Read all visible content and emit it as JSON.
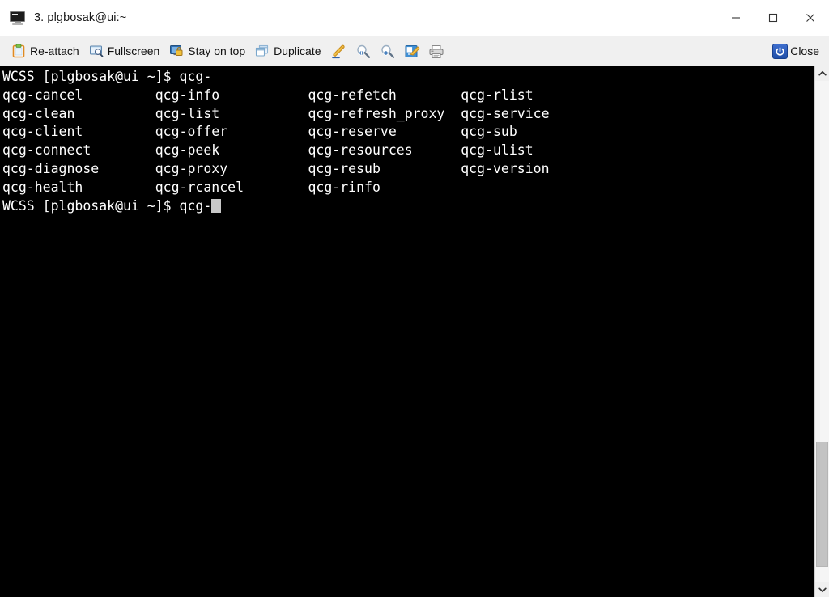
{
  "window": {
    "title": "3. plgbosak@ui:~",
    "app_icon": "monitor-icon",
    "controls": {
      "minimize": "Minimize",
      "maximize": "Maximize",
      "close": "Close"
    }
  },
  "toolbar": {
    "items": [
      {
        "label": "Re-attach",
        "icon": "clipboard-icon"
      },
      {
        "label": "Fullscreen",
        "icon": "fullscreen-icon"
      },
      {
        "label": "Stay on top",
        "icon": "stay-on-top-icon"
      },
      {
        "label": "Duplicate",
        "icon": "duplicate-icon"
      }
    ],
    "icon_buttons": [
      {
        "name": "pencil-icon",
        "tooltip": "Edit"
      },
      {
        "name": "zoom-in-icon",
        "tooltip": "Zoom in"
      },
      {
        "name": "zoom-out-icon",
        "tooltip": "Zoom out"
      },
      {
        "name": "notepad-edit-icon",
        "tooltip": "Edit settings"
      },
      {
        "name": "printer-icon",
        "tooltip": "Print"
      }
    ],
    "close": {
      "label": "Close",
      "icon": "power-icon"
    }
  },
  "terminal": {
    "prompt": "WCSS [plgbosak@ui ~]$ ",
    "typed_command": "qcg-",
    "lines": [
      "WCSS [plgbosak@ui ~]$ qcg-",
      "qcg-cancel         qcg-info           qcg-refetch        qcg-rlist",
      "qcg-clean          qcg-list           qcg-refresh_proxy  qcg-service",
      "qcg-client         qcg-offer          qcg-reserve        qcg-sub",
      "qcg-connect        qcg-peek           qcg-resources      qcg-ulist",
      "qcg-diagnose       qcg-proxy          qcg-resub          qcg-version",
      "qcg-health         qcg-rcancel        qcg-rinfo"
    ],
    "final_prompt_line": "WCSS [plgbosak@ui ~]$ qcg-",
    "completion_columns": [
      [
        "qcg-cancel",
        "qcg-clean",
        "qcg-client",
        "qcg-connect",
        "qcg-diagnose",
        "qcg-health"
      ],
      [
        "qcg-info",
        "qcg-list",
        "qcg-offer",
        "qcg-peek",
        "qcg-proxy",
        "qcg-rcancel"
      ],
      [
        "qcg-refetch",
        "qcg-refresh_proxy",
        "qcg-reserve",
        "qcg-resources",
        "qcg-resub",
        "qcg-rinfo"
      ],
      [
        "qcg-rlist",
        "qcg-service",
        "qcg-sub",
        "qcg-ulist",
        "qcg-version"
      ]
    ],
    "background_color": "#000000",
    "foreground_color": "#ffffff",
    "cursor_color": "#c8c8c8"
  },
  "scrollbar": {
    "up_arrow": "chevron-up-icon",
    "down_arrow": "chevron-down-icon",
    "thumb_top_pct": 72,
    "thumb_height_pct": 25
  }
}
